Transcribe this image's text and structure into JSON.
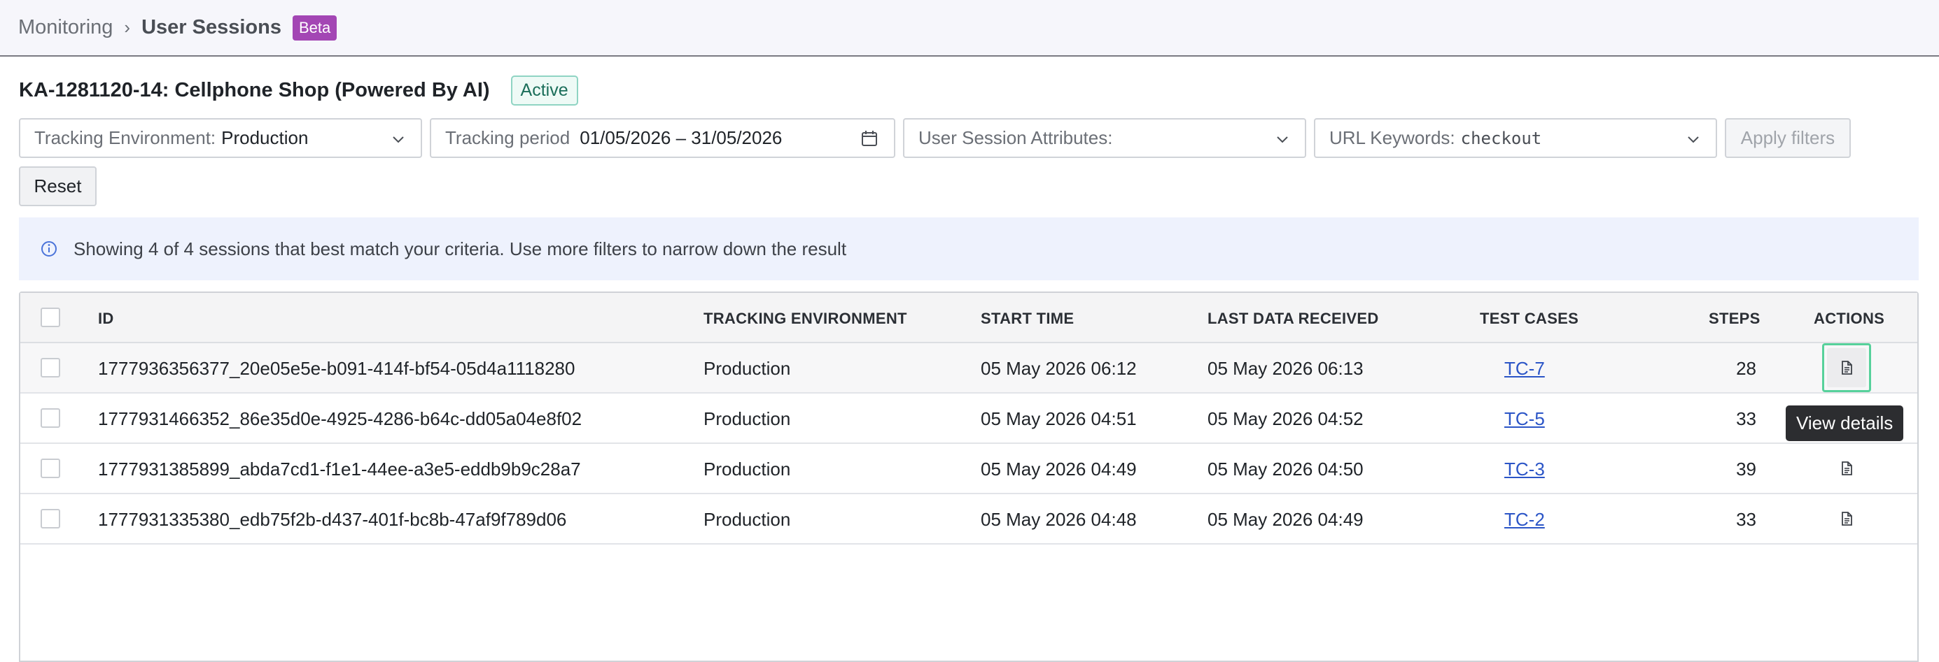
{
  "breadcrumb": {
    "root": "Monitoring",
    "separator": "›",
    "current": "User Sessions",
    "badge": "Beta"
  },
  "page": {
    "title": "KA-1281120-14: Cellphone Shop (Powered By AI)",
    "status": "Active"
  },
  "filters": {
    "environment": {
      "label": "Tracking Environment:",
      "value": "Production"
    },
    "period": {
      "label": "Tracking period",
      "value": "01/05/2026 – 31/05/2026"
    },
    "attributes": {
      "label": "User Session Attributes:",
      "value": ""
    },
    "url": {
      "label": "URL Keywords:",
      "value": "checkout"
    },
    "apply_label": "Apply filters",
    "reset_label": "Reset"
  },
  "info": {
    "text": "Showing 4 of 4 sessions that best match your criteria. Use more filters to narrow down the result"
  },
  "table": {
    "headers": {
      "id": "ID",
      "env": "TRACKING ENVIRONMENT",
      "start": "START TIME",
      "last": "LAST DATA RECEIVED",
      "tests": "TEST CASES",
      "steps": "STEPS",
      "actions": "ACTIONS"
    },
    "rows": [
      {
        "id": "1777936356377_20e05e5e-b091-414f-bf54-05d4a1118280",
        "env": "Production",
        "start": "05 May 2026 06:12",
        "last": "05 May 2026 06:13",
        "test": "TC-7",
        "steps": "28"
      },
      {
        "id": "1777931466352_86e35d0e-4925-4286-b64c-dd05a04e8f02",
        "env": "Production",
        "start": "05 May 2026 04:51",
        "last": "05 May 2026 04:52",
        "test": "TC-5",
        "steps": "33"
      },
      {
        "id": "1777931385899_abda7cd1-f1e1-44ee-a3e5-eddb9b9c28a7",
        "env": "Production",
        "start": "05 May 2026 04:49",
        "last": "05 May 2026 04:50",
        "test": "TC-3",
        "steps": "39"
      },
      {
        "id": "1777931335380_edb75f2b-d437-401f-bc8b-47af9f789d06",
        "env": "Production",
        "start": "05 May 2026 04:48",
        "last": "05 May 2026 04:49",
        "test": "TC-2",
        "steps": "33"
      }
    ]
  },
  "tooltip": {
    "text": "View details"
  },
  "colors": {
    "beta": "#a346b4",
    "active": "#1b6e5a",
    "focus": "#57d19b",
    "link": "#2b55c7"
  },
  "icons": {
    "date": "calendar-icon",
    "info": "info-icon",
    "chevron": "chevron-down-icon",
    "action": "document-icon"
  }
}
